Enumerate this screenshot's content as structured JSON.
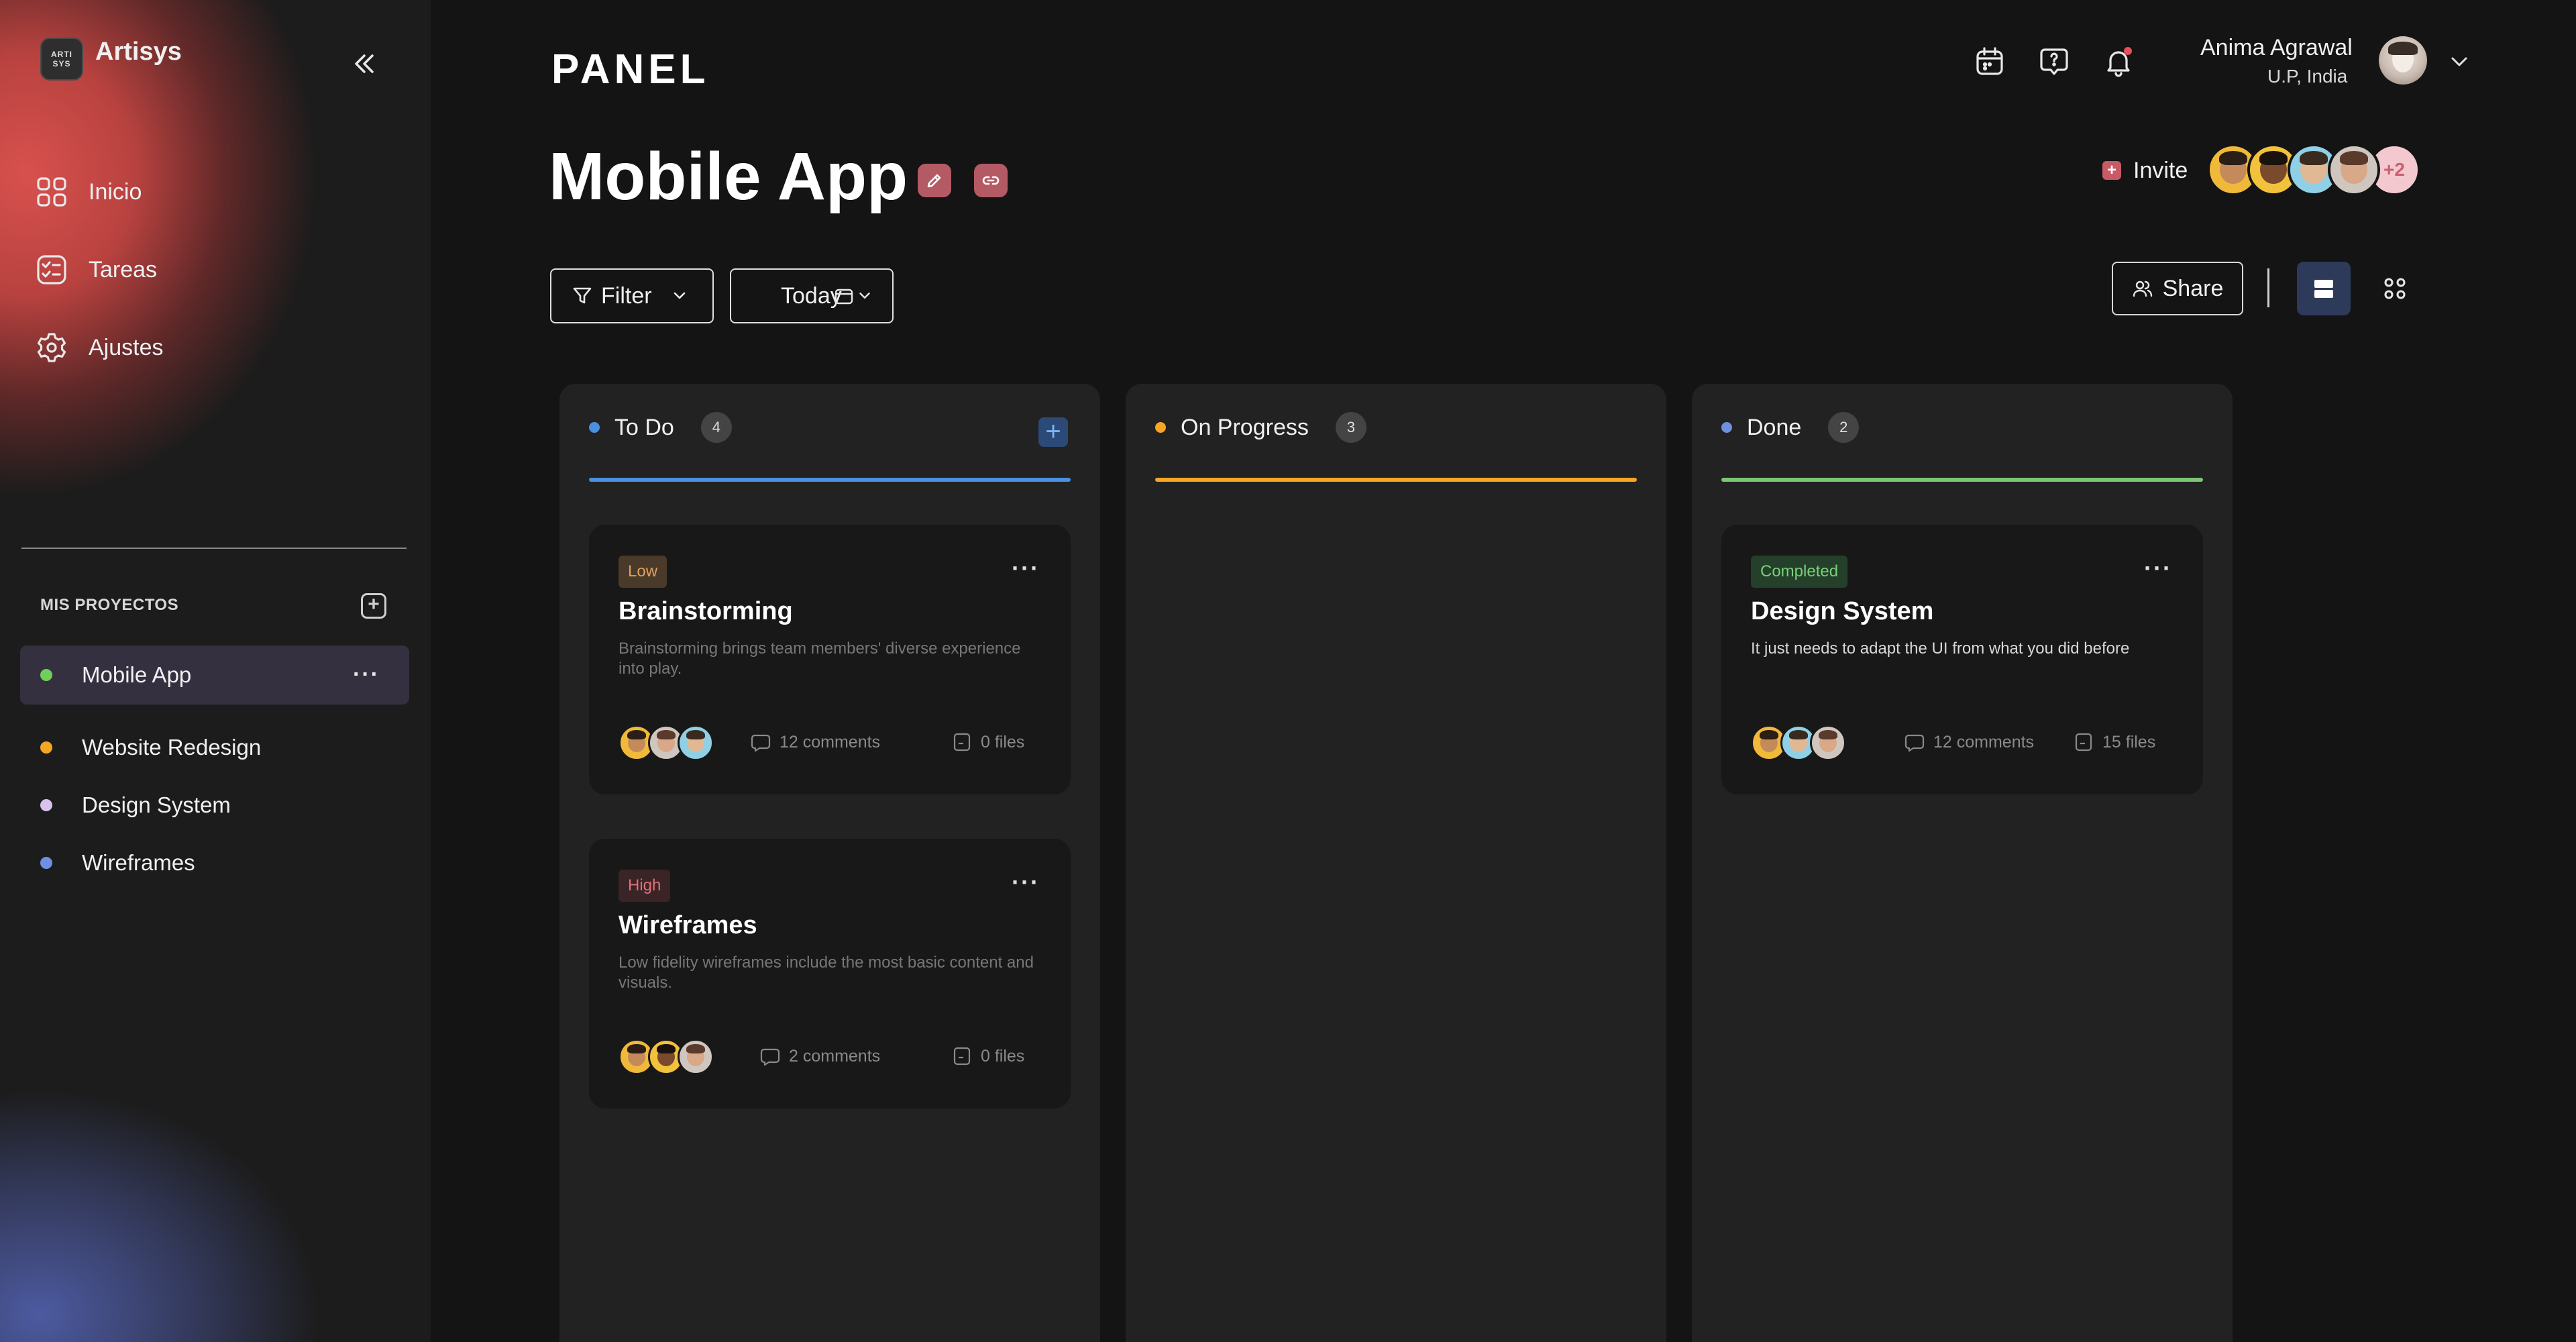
{
  "sidebar": {
    "logo_mark": "ARTI SYS",
    "logo_text": "Artisys",
    "nav": [
      {
        "label": "Inicio",
        "icon": "grid-icon"
      },
      {
        "label": "Tareas",
        "icon": "tasks-icon"
      },
      {
        "label": "Ajustes",
        "icon": "gear-icon"
      }
    ],
    "projects_heading": "MIS PROYECTOS",
    "projects": [
      {
        "label": "Mobile App",
        "color": "#6fcf5a",
        "active": true
      },
      {
        "label": "Website Redesign",
        "color": "#f5a623",
        "active": false
      },
      {
        "label": "Design System",
        "color": "#d9c2ee",
        "active": false
      },
      {
        "label": "Wireframes",
        "color": "#6f8fe0",
        "active": false
      }
    ]
  },
  "header": {
    "brand": "PANEL",
    "user_name": "Anima Agrawal",
    "user_location": "U.P, India"
  },
  "page": {
    "title": "Mobile App",
    "invite_label": "Invite",
    "invite_more": "+2",
    "filter_label": "Filter",
    "date_label": "Today",
    "share_label": "Share"
  },
  "columns": [
    {
      "title": "To Do",
      "count": "4",
      "color": "#4a90e2"
    },
    {
      "title": "On Progress",
      "count": "3",
      "color": "#f5a623"
    },
    {
      "title": "Done",
      "count": "2",
      "color": "#7ac774"
    }
  ],
  "cards": [
    {
      "tag": "Low",
      "tag_bg": "#4a3a2a",
      "tag_color": "#e0a060",
      "title": "Brainstorming",
      "description": "Brainstorming brings team members' diverse experience into play.",
      "comments": "12 comments",
      "files": "0 files"
    },
    {
      "tag": "High",
      "tag_bg": "#3a2426",
      "tag_color": "#e0707a",
      "title": "Wireframes",
      "description": "Low fidelity wireframes include the most basic content and visuals.",
      "comments": "2 comments",
      "files": "0 files"
    },
    {
      "tag": "Completed",
      "tag_bg": "#24402a",
      "tag_color": "#7ad07a",
      "title": "Design System",
      "description": "It just needs to adapt the UI from what you did before",
      "comments": "12 comments",
      "files": "15 files"
    }
  ]
}
